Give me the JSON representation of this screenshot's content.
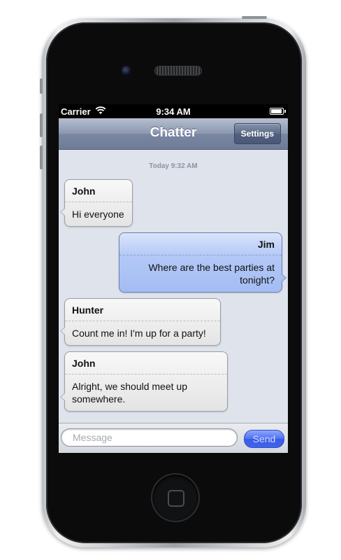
{
  "status_bar": {
    "carrier": "Carrier",
    "wifi_icon": "wifi-icon",
    "time": "9:34 AM",
    "battery_icon": "battery-icon"
  },
  "nav_bar": {
    "title": "Chatter",
    "settings_label": "Settings"
  },
  "chat": {
    "timestamp": "Today 9:32 AM",
    "messages": [
      {
        "sender": "John",
        "text": "Hi everyone",
        "direction": "incoming"
      },
      {
        "sender": "Jim",
        "text": "Where are the best parties at tonight?",
        "direction": "outgoing"
      },
      {
        "sender": "Hunter",
        "text": "Count me in! I'm up for a party!",
        "direction": "incoming"
      },
      {
        "sender": "John",
        "text": "Alright, we should meet up somewhere.",
        "direction": "incoming"
      }
    ]
  },
  "composer": {
    "placeholder": "Message",
    "value": "",
    "send_label": "Send"
  },
  "colors": {
    "nav_bar": "#7a87a3",
    "incoming_bubble": "#e6e6e6",
    "outgoing_bubble": "#a3bdf4",
    "chat_background": "#dfe3ec",
    "send_button": "#4f6ff0"
  }
}
